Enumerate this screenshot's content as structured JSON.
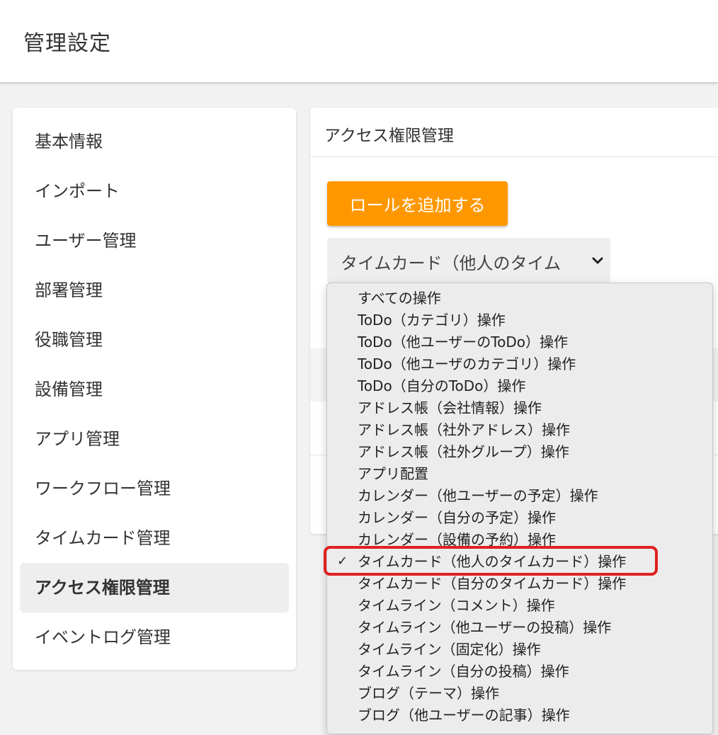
{
  "header": {
    "title": "管理設定"
  },
  "sidebar": {
    "items": [
      {
        "label": "基本情報",
        "active": false
      },
      {
        "label": "インポート",
        "active": false
      },
      {
        "label": "ユーザー管理",
        "active": false
      },
      {
        "label": "部署管理",
        "active": false
      },
      {
        "label": "役職管理",
        "active": false
      },
      {
        "label": "設備管理",
        "active": false
      },
      {
        "label": "アプリ管理",
        "active": false
      },
      {
        "label": "ワークフロー管理",
        "active": false
      },
      {
        "label": "タイムカード管理",
        "active": false
      },
      {
        "label": "アクセス権限管理",
        "active": true
      },
      {
        "label": "イベントログ管理",
        "active": false
      }
    ]
  },
  "main": {
    "title": "アクセス権限管理",
    "add_role_label": "ロールを追加する",
    "select": {
      "value": "タイムカード（他人のタイム",
      "chevron_icon": "chevron-down-icon"
    }
  },
  "dropdown": {
    "options": [
      {
        "label": "すべての操作",
        "selected": false
      },
      {
        "label": "ToDo（カテゴリ）操作",
        "selected": false
      },
      {
        "label": "ToDo（他ユーザーのToDo）操作",
        "selected": false
      },
      {
        "label": "ToDo（他ユーザのカテゴリ）操作",
        "selected": false
      },
      {
        "label": "ToDo（自分のToDo）操作",
        "selected": false
      },
      {
        "label": "アドレス帳（会社情報）操作",
        "selected": false
      },
      {
        "label": "アドレス帳（社外アドレス）操作",
        "selected": false
      },
      {
        "label": "アドレス帳（社外グループ）操作",
        "selected": false
      },
      {
        "label": "アプリ配置",
        "selected": false
      },
      {
        "label": "カレンダー（他ユーザーの予定）操作",
        "selected": false
      },
      {
        "label": "カレンダー（自分の予定）操作",
        "selected": false
      },
      {
        "label": "カレンダー（設備の予約）操作",
        "selected": false
      },
      {
        "label": "タイムカード（他人のタイムカード）操作",
        "selected": true
      },
      {
        "label": "タイムカード（自分のタイムカード）操作",
        "selected": false
      },
      {
        "label": "タイムライン（コメント）操作",
        "selected": false
      },
      {
        "label": "タイムライン（他ユーザーの投稿）操作",
        "selected": false
      },
      {
        "label": "タイムライン（固定化）操作",
        "selected": false
      },
      {
        "label": "タイムライン（自分の投稿）操作",
        "selected": false
      },
      {
        "label": "ブログ（テーマ）操作",
        "selected": false
      },
      {
        "label": "ブログ（他ユーザーの記事）操作",
        "selected": false
      }
    ],
    "check_glyph": "✓",
    "highlight_color": "#e02020"
  },
  "colors": {
    "accent": "#ff9800",
    "active_bg": "#eeeeee",
    "page_bg": "#f2f2f2"
  }
}
